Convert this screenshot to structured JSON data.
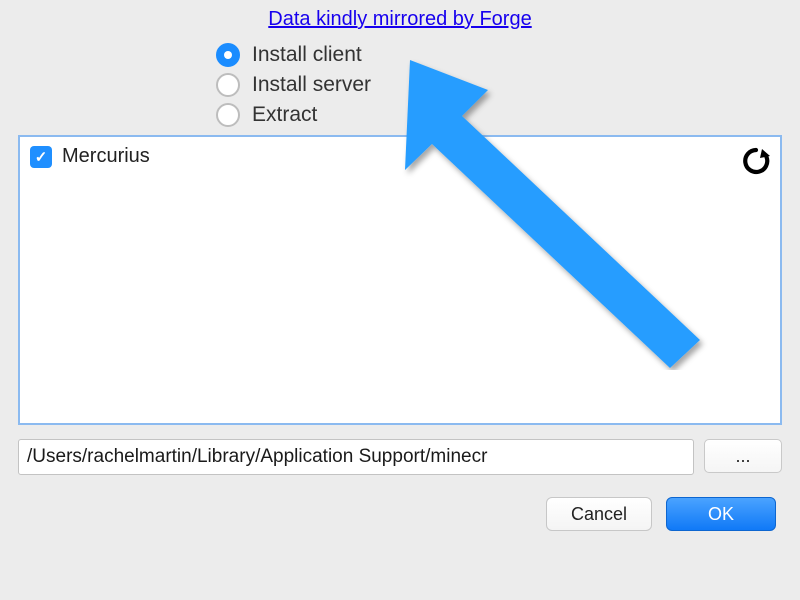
{
  "header": {
    "link_text": "Data kindly mirrored by Forge"
  },
  "radios": {
    "install_client": "Install client",
    "install_server": "Install server",
    "extract": "Extract"
  },
  "list": {
    "item0_label": "Mercurius"
  },
  "path": {
    "value": "/Users/rachelmartin/Library/Application Support/minecr",
    "browse_label": "..."
  },
  "buttons": {
    "cancel": "Cancel",
    "ok": "OK"
  },
  "colors": {
    "accent": "#1a8cff",
    "link": "#1700ee"
  }
}
